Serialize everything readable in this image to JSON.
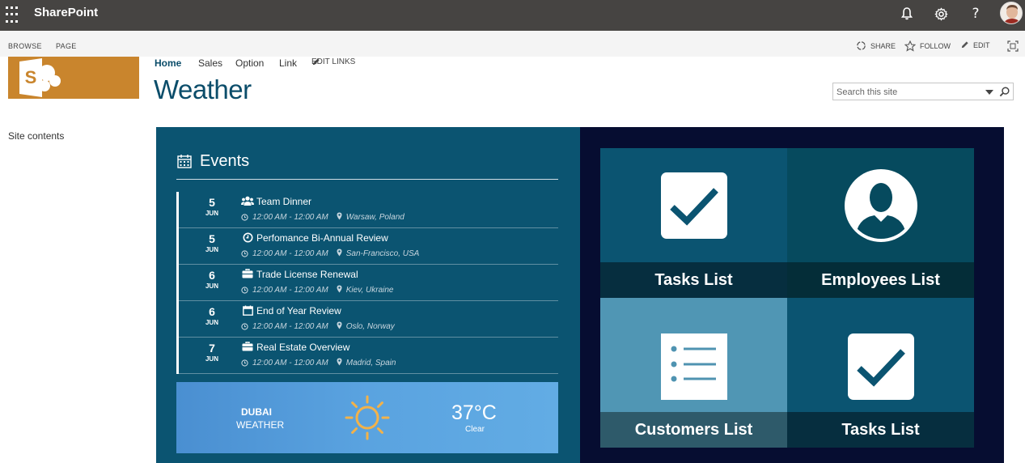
{
  "suitebar": {
    "app_name": "SharePoint",
    "help_label": "?",
    "icons": [
      "waffle-icon",
      "bell-icon",
      "gear-icon",
      "help-icon",
      "avatar"
    ]
  },
  "ribbon": {
    "tabs": [
      "BROWSE",
      "PAGE"
    ],
    "actions": [
      {
        "label": "SHARE",
        "icon": "share-icon"
      },
      {
        "label": "FOLLOW",
        "icon": "star-icon"
      },
      {
        "label": "EDIT",
        "icon": "pencil-icon"
      }
    ]
  },
  "nav": {
    "site_contents": "Site contents",
    "top_links": [
      "Home",
      "Sales",
      "Option",
      "Link"
    ],
    "edit_links": "EDIT LINKS"
  },
  "page": {
    "title": "Weather",
    "search_placeholder": "Search this site"
  },
  "events": {
    "title": "Events",
    "items": [
      {
        "day": "5",
        "month": "JUN",
        "title": "Team Dinner",
        "icon": "group-icon",
        "time": "12:00 AM - 12:00 AM",
        "location": "Warsaw, Poland"
      },
      {
        "day": "5",
        "month": "JUN",
        "title": "Perfomance Bi-Annual Review",
        "icon": "clock-icon",
        "time": "12:00 AM - 12:00 AM",
        "location": "San-Francisco, USA"
      },
      {
        "day": "6",
        "month": "JUN",
        "title": "Trade License Renewal",
        "icon": "briefcase-icon",
        "time": "12:00 AM - 12:00 AM",
        "location": "Kiev, Ukraine"
      },
      {
        "day": "6",
        "month": "JUN",
        "title": "End of Year Review",
        "icon": "calendar-icon",
        "time": "12:00 AM - 12:00 AM",
        "location": "Oslo, Norway"
      },
      {
        "day": "7",
        "month": "JUN",
        "title": "Real Estate Overview",
        "icon": "briefcase-icon",
        "time": "12:00 AM - 12:00 AM",
        "location": "Madrid, Spain"
      }
    ]
  },
  "weather": {
    "city": "DUBAI",
    "label": "WEATHER",
    "temperature": "37°C",
    "condition": "Clear",
    "icon": "sun-icon"
  },
  "tiles": [
    {
      "label": "Tasks List",
      "icon": "checkmark-icon",
      "bg": "#0b5471",
      "label_bg": "#062e3f"
    },
    {
      "label": "Employees List",
      "icon": "person-icon",
      "bg": "#064a5e",
      "label_bg": "#042d38"
    },
    {
      "label": "Customers List",
      "icon": "list-icon",
      "bg": "#5096b4",
      "label_bg": "#2e5a6a"
    },
    {
      "label": "Tasks List",
      "icon": "checkmark-icon",
      "bg": "#0b5471",
      "label_bg": "#062e3f"
    }
  ],
  "colors": {
    "suitebar": "#464442",
    "brand_title": "#0b4d6a",
    "logo_bg": "#c9852d",
    "events_panel": "#0b5471",
    "tiles_panel": "#060d31"
  }
}
